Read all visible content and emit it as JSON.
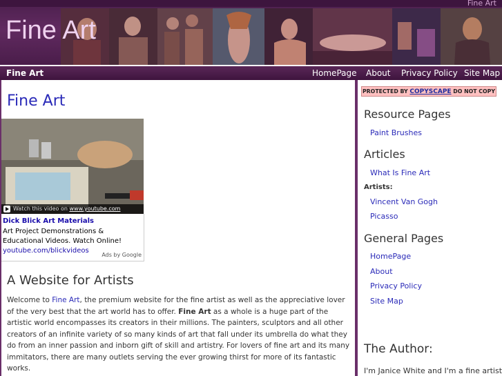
{
  "header": {
    "tagline": "Fine Art",
    "logo": "Fine Art"
  },
  "nav": {
    "site_name": "Fine Art",
    "links": [
      "HomePage",
      "About",
      "Privacy Policy",
      "Site Map"
    ]
  },
  "main": {
    "title": "Fine Art",
    "video": {
      "caption_prefix": "Watch this video on",
      "caption_domain": "www.youtube.com"
    },
    "ad": {
      "title": "Dick Blick Art Materials",
      "text": "Art Project Demonstrations & Educational Videos. Watch Online!",
      "url": "youtube.com/blickvideos",
      "attribution": "Ads by Google"
    },
    "section_heading": "A Website for Artists",
    "intro": {
      "p1": "Welcome to ",
      "link": "Fine Art",
      "p2": ", the premium website for the fine artist as well as the appreciative lover of the very best that the art world has to offer. ",
      "bold": "Fine Art",
      "p3": " as a whole is a huge part of the artistic world encompasses its creators in their millions. The painters, sculptors and all other creators of an infinite variety of so many kinds of art that fall under its umbrella do what they do from an inner passion and inborn gift of skill and artistry. For lovers of fine art and its many immitators, there are many outlets serving the ever growing thirst for more of its fantastic works."
    }
  },
  "sidebar": {
    "copyscape": {
      "prefix": "PROTECTED BY",
      "brand": "COPYSCAPE",
      "suffix": "DO NOT COPY"
    },
    "resource_heading": "Resource Pages",
    "resource_links": [
      "Paint Brushes"
    ],
    "articles_heading": "Articles",
    "article_links": [
      "What Is Fine Art"
    ],
    "artists_label": "Artists:",
    "artist_links": [
      "Vincent Van Gogh",
      "Picasso"
    ],
    "general_heading": "General Pages",
    "general_links": [
      "HomePage",
      "About",
      "Privacy Policy",
      "Site Map"
    ],
    "author_heading": "The Author:",
    "author_text": "I'm Janice White and I'm a fine artist"
  },
  "colors": {
    "header_purple": "#4a2249",
    "border_purple": "#6a2f69",
    "link_blue": "#2a2ab8"
  }
}
